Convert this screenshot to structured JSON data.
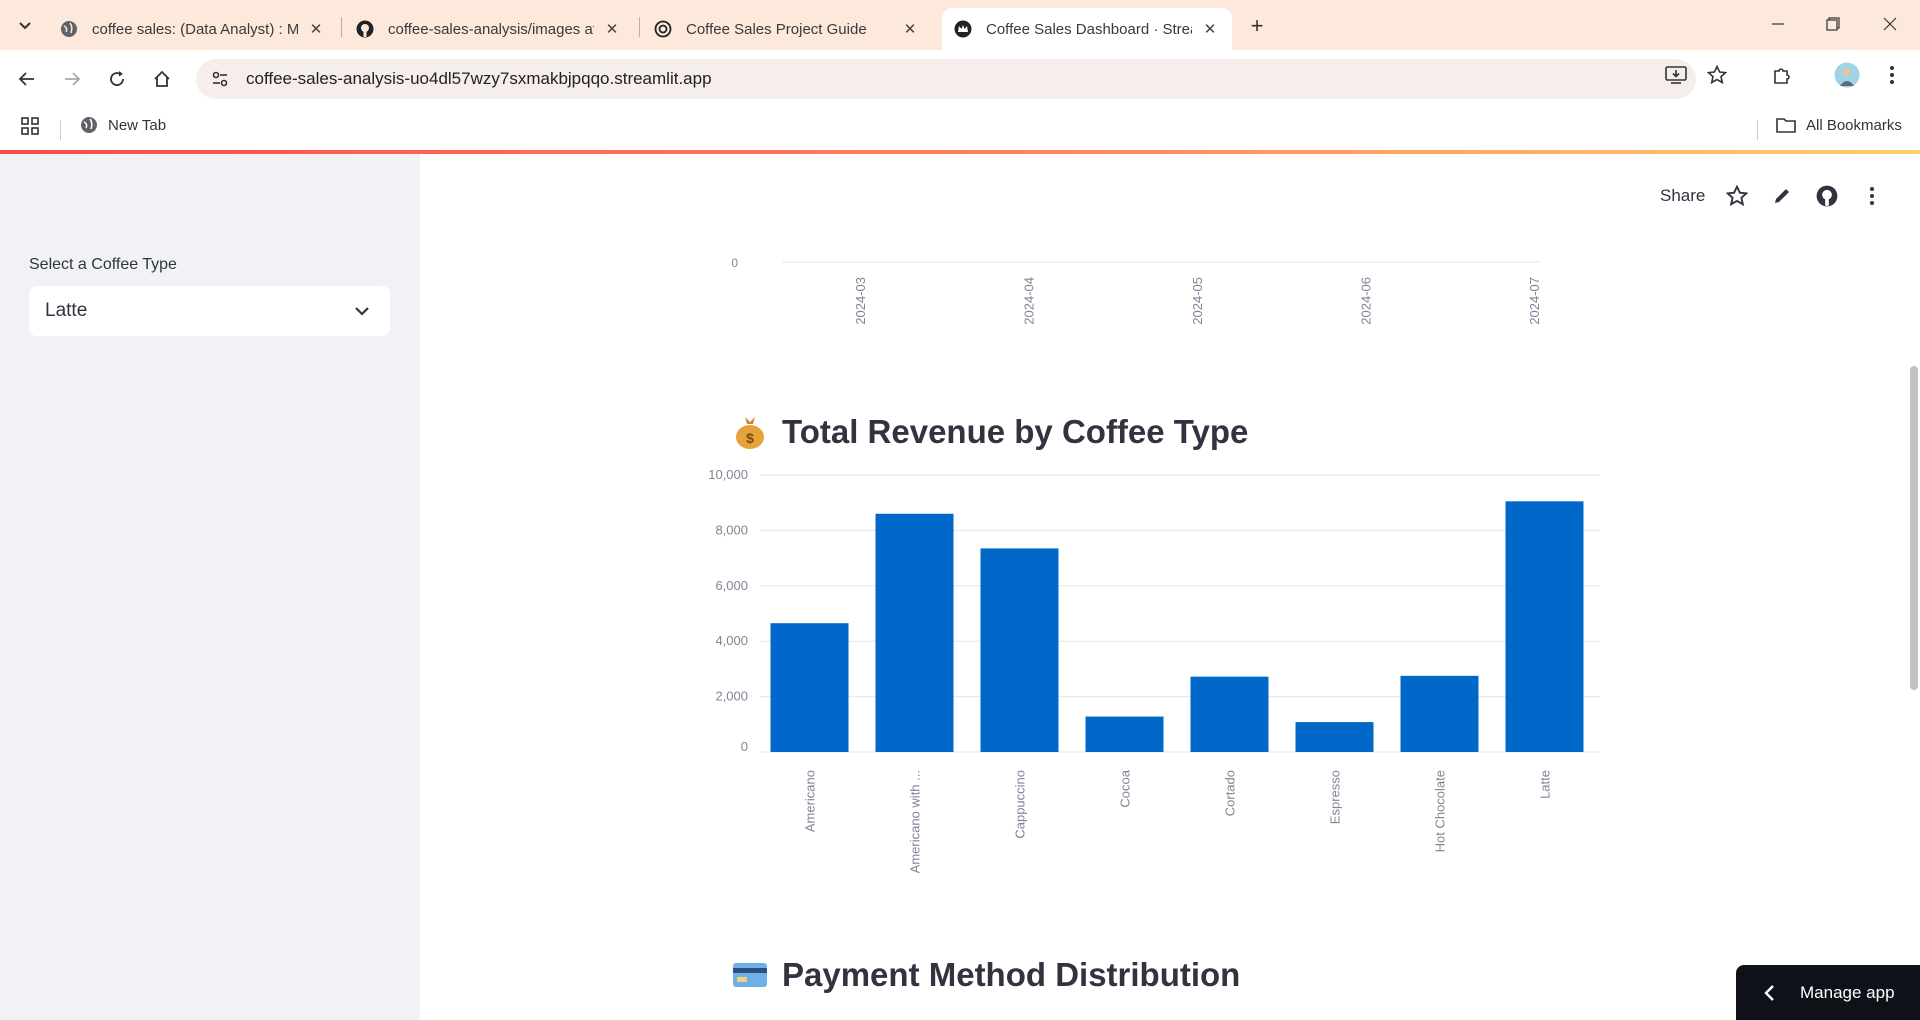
{
  "browser": {
    "tabs": [
      {
        "title": "coffee sales: (Data Analyst) : ML",
        "icon": "globe-icon",
        "active": false
      },
      {
        "title": "coffee-sales-analysis/images at",
        "icon": "github-icon",
        "active": false
      },
      {
        "title": "Coffee Sales Project Guide",
        "icon": "openai-icon",
        "active": false
      },
      {
        "title": "Coffee Sales Dashboard · Strean",
        "icon": "streamlit-crown-icon",
        "active": true
      }
    ],
    "url": "coffee-sales-analysis-uo4dl57wzy7sxmakbjpqqo.streamlit.app",
    "bookmarks": {
      "new_tab": "New Tab",
      "all_bookmarks": "All Bookmarks"
    },
    "accent_colors": {
      "tabbar": "#fde8dc",
      "loadbar_start": "#ff4b4b",
      "loadbar_end": "#ffcf6a"
    }
  },
  "sidebar": {
    "select_label": "Select a Coffee Type",
    "select_value": "Latte"
  },
  "header": {
    "share_label": "Share",
    "icons": [
      "star-icon",
      "edit-pencil-icon",
      "github-icon",
      "more-vertical-icon"
    ]
  },
  "monthly_chart": {
    "y_zero_label": "0",
    "x_tick_labels": [
      "2024-03",
      "2024-04",
      "2024-05",
      "2024-06",
      "2024-07"
    ]
  },
  "revenue_section": {
    "emoji": "money-bag-icon",
    "title": "Total Revenue by Coffee Type"
  },
  "payment_section": {
    "emoji": "credit-card-icon",
    "title": "Payment Method Distribution"
  },
  "chart_data": {
    "type": "bar",
    "title": "Total Revenue by Coffee Type",
    "categories": [
      "Americano",
      "Americano with ...",
      "Cappuccino",
      "Cocoa",
      "Cortado",
      "Espresso",
      "Hot Chocolate",
      "Latte"
    ],
    "values": [
      4650,
      8600,
      7350,
      1280,
      2720,
      1080,
      2750,
      9050
    ],
    "y_tick_labels": [
      "0",
      "2,000",
      "4,000",
      "6,000",
      "8,000",
      "10,000"
    ],
    "y_ticks": [
      0,
      2000,
      4000,
      6000,
      8000,
      10000
    ],
    "ylim": [
      0,
      10000
    ],
    "xlabel": "",
    "ylabel": "",
    "grid": true,
    "bar_color": "#0068c9"
  },
  "manage_app_label": "Manage app"
}
